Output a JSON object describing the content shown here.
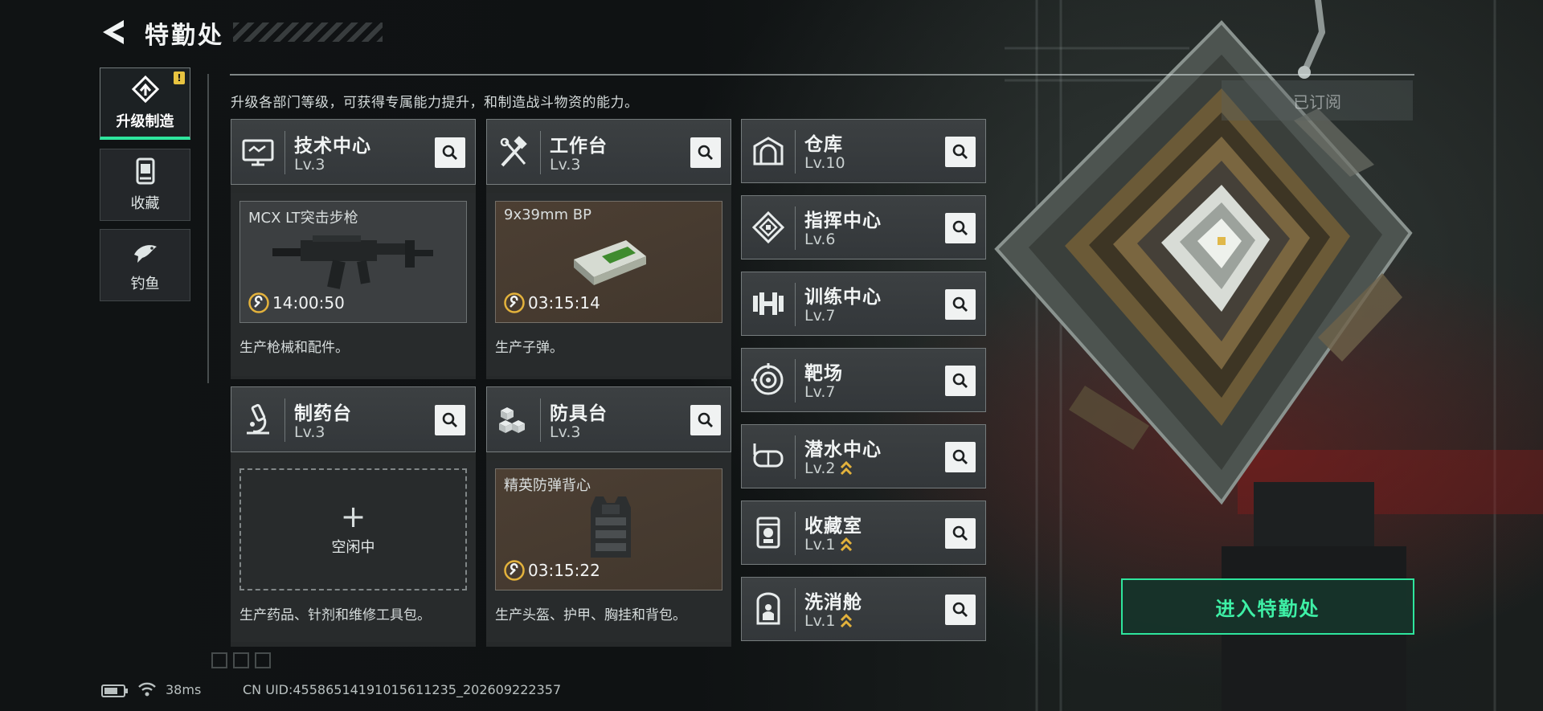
{
  "header": {
    "title": "特勤处",
    "description": "升级各部门等级，可获得专属能力提升，和制造战斗物资的能力。"
  },
  "sidebar": {
    "items": [
      {
        "label": "升级制造",
        "icon": "upgrade-icon",
        "active": true,
        "alert": "!"
      },
      {
        "label": "收藏",
        "icon": "collection-icon",
        "active": false
      },
      {
        "label": "钓鱼",
        "icon": "fish-icon",
        "active": false
      }
    ]
  },
  "stations": [
    {
      "name": "技术中心",
      "level": "Lv.3",
      "icon": "monitor-icon",
      "slot": {
        "item": "MCX LT突击步枪",
        "timer": "14:00:50",
        "style": "gray"
      },
      "description": "生产枪械和配件。"
    },
    {
      "name": "工作台",
      "level": "Lv.3",
      "icon": "tools-icon",
      "slot": {
        "item": "9x39mm BP",
        "timer": "03:15:14",
        "style": "brown"
      },
      "description": "生产子弹。"
    },
    {
      "name": "制药台",
      "level": "Lv.3",
      "icon": "microscope-icon",
      "slot": {
        "status": "空闲中",
        "empty": true
      },
      "description": "生产药品、针剂和维修工具包。"
    },
    {
      "name": "防具台",
      "level": "Lv.3",
      "icon": "armor-blocks-icon",
      "slot": {
        "item": "精英防弹背心",
        "timer": "03:15:22",
        "style": "brown"
      },
      "description": "生产头盔、护甲、胸挂和背包。"
    }
  ],
  "departments": [
    {
      "name": "仓库",
      "level": "Lv.10",
      "icon": "warehouse-icon",
      "upgradable": false
    },
    {
      "name": "指挥中心",
      "level": "Lv.6",
      "icon": "command-icon",
      "upgradable": false
    },
    {
      "name": "训练中心",
      "level": "Lv.7",
      "icon": "dumbbell-icon",
      "upgradable": false
    },
    {
      "name": "靶场",
      "level": "Lv.7",
      "icon": "target-icon",
      "upgradable": false
    },
    {
      "name": "潜水中心",
      "level": "Lv.2",
      "icon": "diving-mask-icon",
      "upgradable": true
    },
    {
      "name": "收藏室",
      "level": "Lv.1",
      "icon": "display-case-icon",
      "upgradable": true
    },
    {
      "name": "洗消舱",
      "level": "Lv.1",
      "icon": "decon-pod-icon",
      "upgradable": true
    }
  ],
  "right_panel": {
    "subscribed_label": "已订阅",
    "enter_label": "进入特勤处"
  },
  "status_bar": {
    "ping": "38ms",
    "uid": "CN UID:4558651419101561123​5_202609222357"
  },
  "colors": {
    "accent_green": "#2ee59d",
    "upgrade_gold": "#e3b23c",
    "alert_yellow": "#e8c440"
  }
}
